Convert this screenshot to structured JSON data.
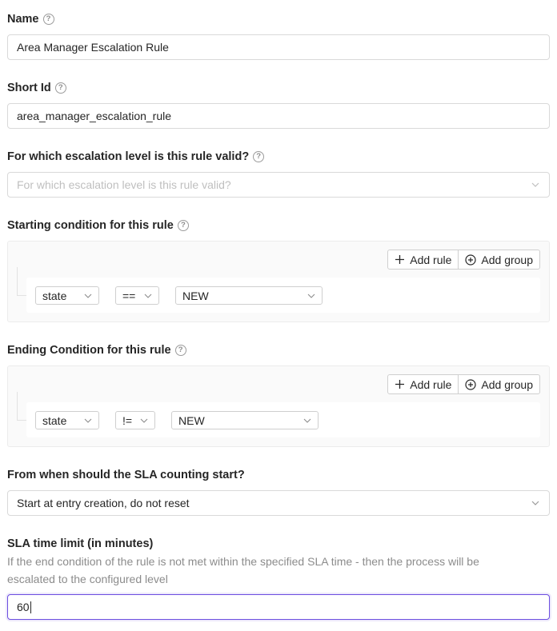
{
  "name": {
    "label": "Name",
    "value": "Area Manager Escalation Rule"
  },
  "short_id": {
    "label": "Short Id",
    "value": "area_manager_escalation_rule"
  },
  "escalation_level": {
    "label": "For which escalation level is this rule valid?",
    "placeholder": "For which escalation level is this rule valid?"
  },
  "starting_condition": {
    "label": "Starting condition for this rule",
    "add_rule": "Add rule",
    "add_group": "Add group",
    "rule": {
      "field": "state",
      "operator": "==",
      "value": "NEW"
    }
  },
  "ending_condition": {
    "label": "Ending Condition for this rule",
    "add_rule": "Add rule",
    "add_group": "Add group",
    "rule": {
      "field": "state",
      "operator": "!=",
      "value": "NEW"
    }
  },
  "sla_start": {
    "label": "From when should the SLA counting start?",
    "value": "Start at entry creation, do not reset"
  },
  "sla_limit": {
    "label": "SLA time limit (in minutes)",
    "description": "If the end condition of the rule is not met within the specified SLA time - then the process will be escalated to the configured level",
    "value": "60"
  },
  "icons": [
    "help-icon",
    "chevron-down-icon",
    "plus-icon",
    "plus-circle-icon"
  ]
}
